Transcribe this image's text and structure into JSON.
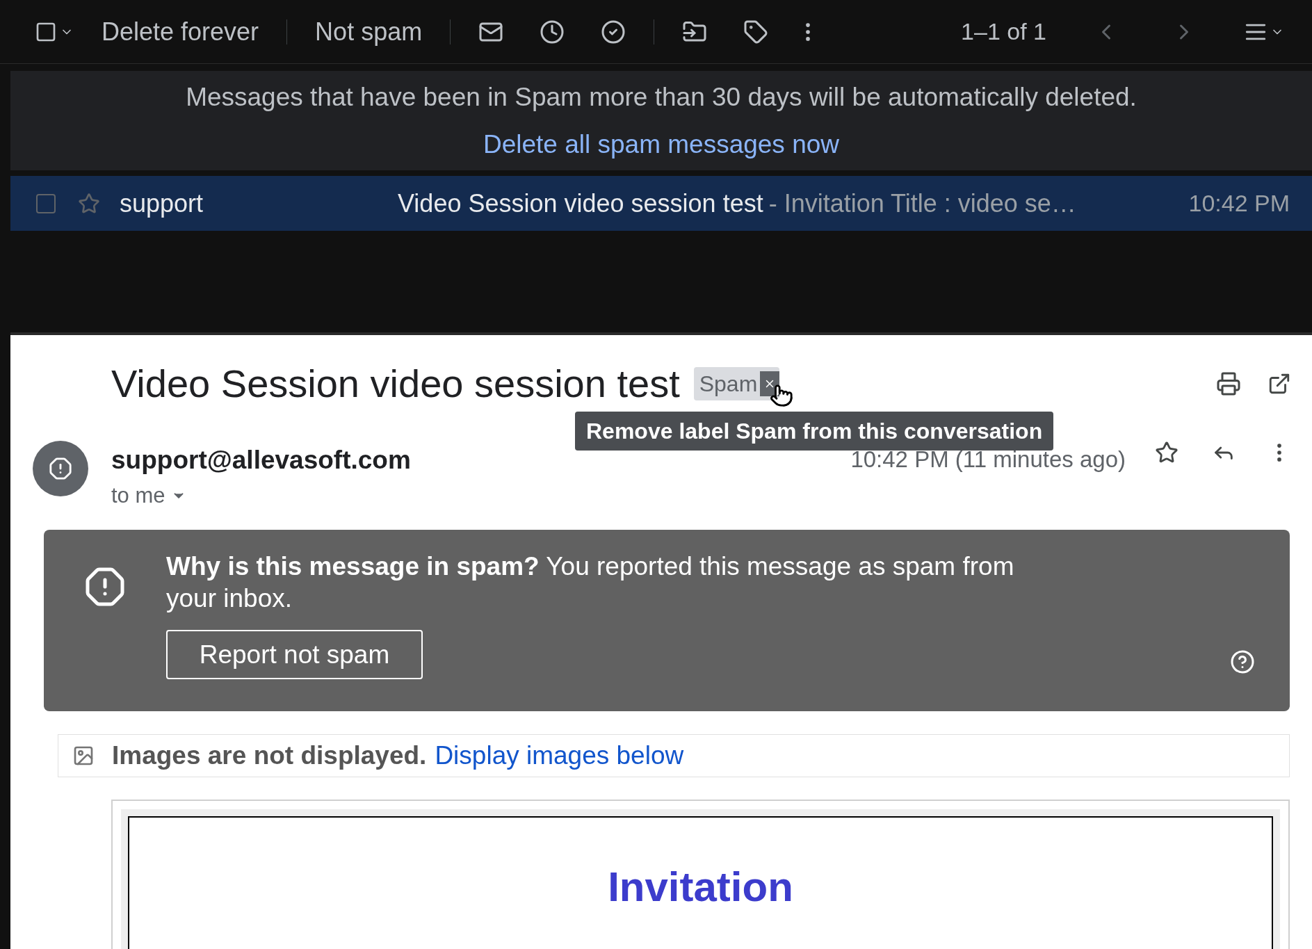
{
  "toolbar": {
    "select_all_checked": false,
    "actions": [
      {
        "label": "Delete forever"
      },
      {
        "label": "Not spam"
      }
    ],
    "pagination": "1–1 of 1"
  },
  "notice": {
    "text": "Messages that have been in Spam more than 30 days will be automatically deleted.",
    "link": "Delete all spam messages now"
  },
  "messages": [
    {
      "sender": "support",
      "subject": "Video Session video session test",
      "snippet": "- Invitation Title : video se…",
      "time": "10:42 PM",
      "selected": true,
      "checked": false,
      "starred": false
    }
  ],
  "message": {
    "subject": "Video Session video session test",
    "label": "Spam",
    "tooltip": "Remove label Spam from this conversation",
    "from": "support@allevasoft.com",
    "to": "to me",
    "time": "10:42 PM (11 minutes ago)",
    "starred": false,
    "warning": {
      "text": "**Why is this message in spam?** You reported this message as spam from your inbox.",
      "button": "Report not spam"
    },
    "images_notice": {
      "text": "Images are not displayed.",
      "link": "Display images below"
    },
    "body_heading": "Invitation"
  }
}
